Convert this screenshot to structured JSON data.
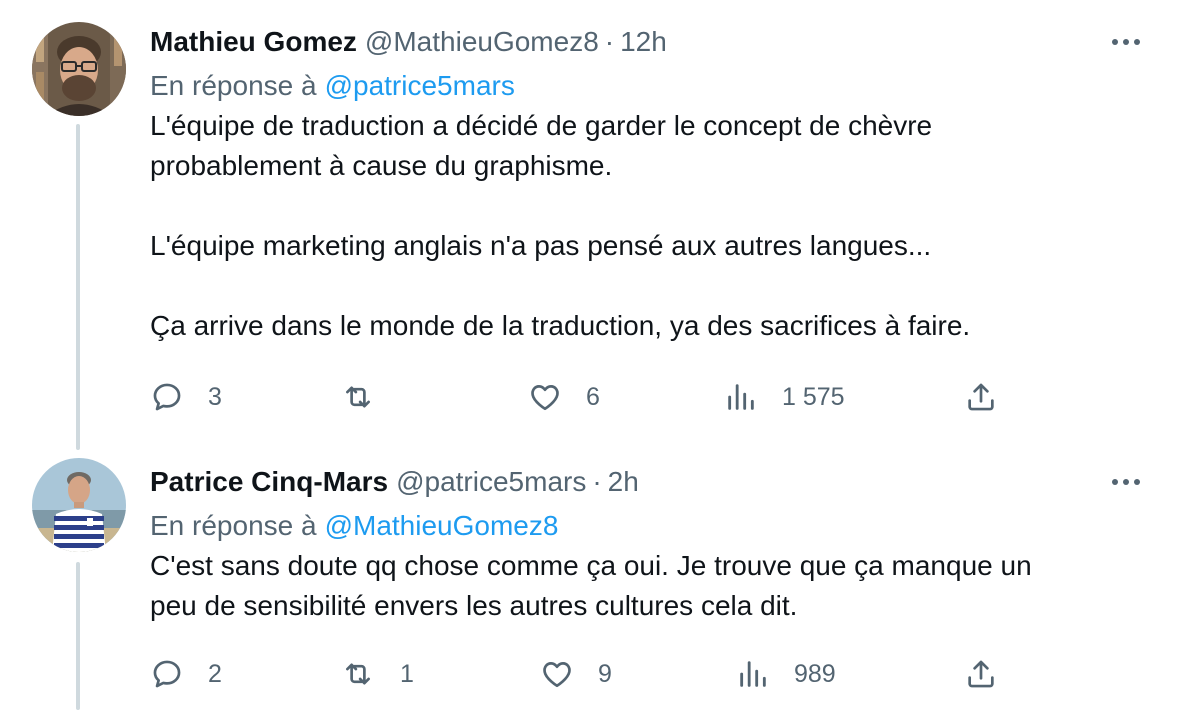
{
  "colors": {
    "text": "#0f1419",
    "secondary": "#536471",
    "link": "#1d9bf0",
    "thread_line": "#cfd9de"
  },
  "tweets": [
    {
      "author_name": "Mathieu Gomez",
      "handle": "@MathieuGomez8",
      "separator": "·",
      "time": "12h",
      "reply_prefix": "En réponse à",
      "reply_to": "@patrice5mars",
      "text": "L'équipe de traduction a décidé de garder le concept de chèvre\nprobablement à cause du graphisme.\n\nL'équipe marketing anglais n'a pas pensé aux autres langues...\n\nÇa arrive dans le monde de la traduction, ya des sacrifices à faire.",
      "replies": "3",
      "retweets": "",
      "likes": "6",
      "views": "1 575",
      "avatar_icon": "bearded-man-avatar"
    },
    {
      "author_name": "Patrice Cinq-Mars",
      "handle": "@patrice5mars",
      "separator": "·",
      "time": "2h",
      "reply_prefix": "En réponse à",
      "reply_to": "@MathieuGomez8",
      "text": "C'est sans doute qq chose comme ça oui. Je trouve que ça manque un\npeu de sensibilité envers les autres cultures cela dit.",
      "replies": "2",
      "retweets": "1",
      "likes": "9",
      "views": "989",
      "avatar_icon": "striped-shirt-man-avatar"
    }
  ]
}
